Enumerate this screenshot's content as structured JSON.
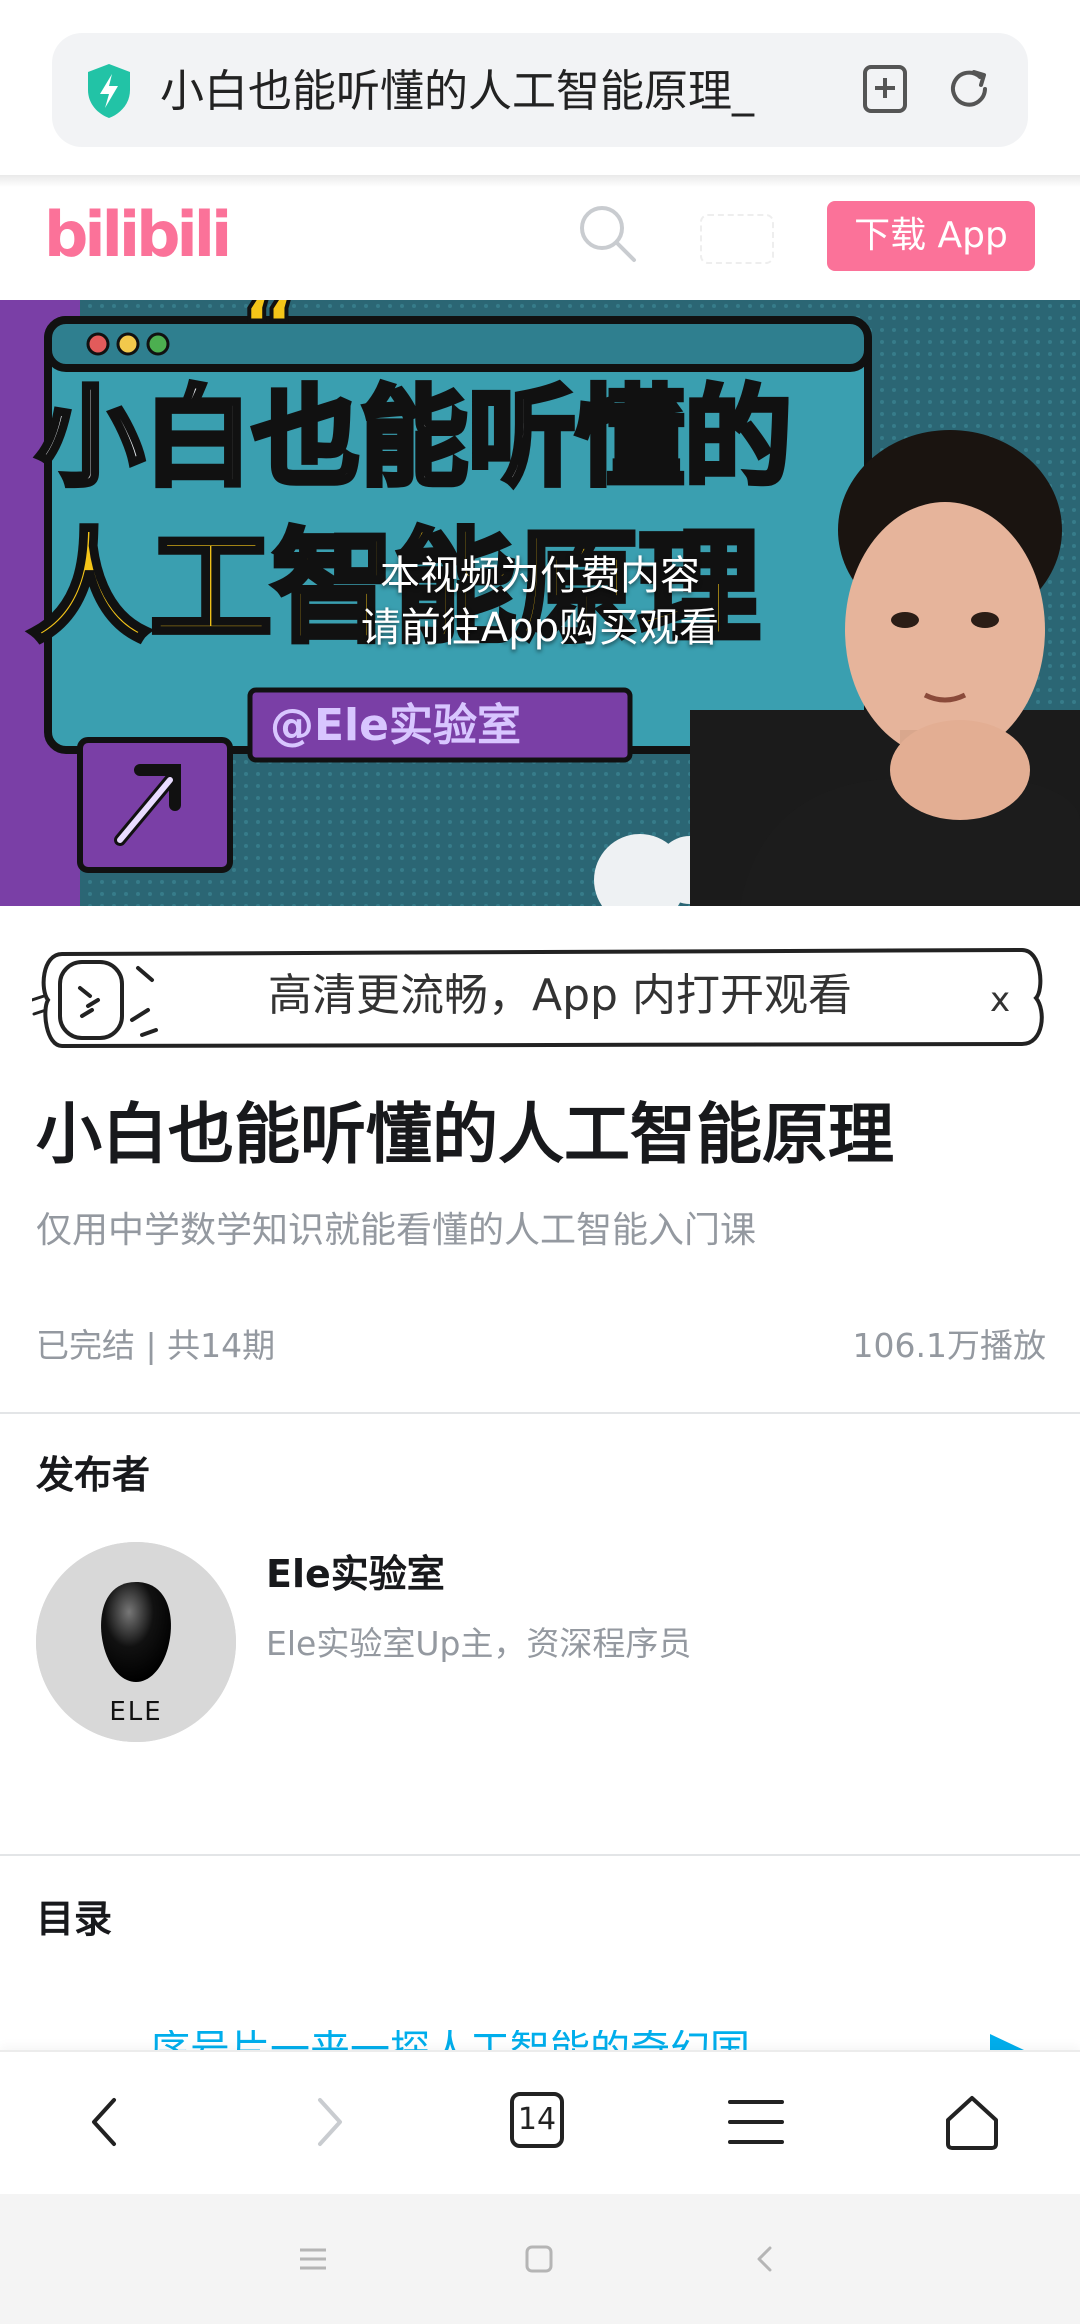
{
  "browser": {
    "address_text": "小白也能听懂的人工智能原理_",
    "tab_count": "14"
  },
  "header": {
    "logo": "bilibili",
    "download_button": "下载 App"
  },
  "video": {
    "thumbnail_title_line1": "小白也能听懂的",
    "thumbnail_title_line2": "人工智能原理",
    "thumbnail_handle": "@Ele实验室",
    "paid_notice_line1": "本视频为付费内容",
    "paid_notice_line2": "请前往App购买观看"
  },
  "app_prompt": {
    "text": "高清更流畅，App 内打开观看",
    "close": "x"
  },
  "course": {
    "title": "小白也能听懂的人工智能原理",
    "subtitle": "仅用中学数学知识就能看懂的人工智能入门课",
    "status": "已完结 | 共14期",
    "plays": "106.1万播放"
  },
  "publisher": {
    "section_label": "发布者",
    "name": "Ele实验室",
    "description": "Ele实验室Up主，资深程序员",
    "avatar_text": "ELE"
  },
  "toc": {
    "section_label": "目录",
    "first_item_partial": "序号片一来一探人工智能的奇幻国"
  },
  "colors": {
    "brand_pink": "#fb7299",
    "link_blue": "#00aeec"
  }
}
